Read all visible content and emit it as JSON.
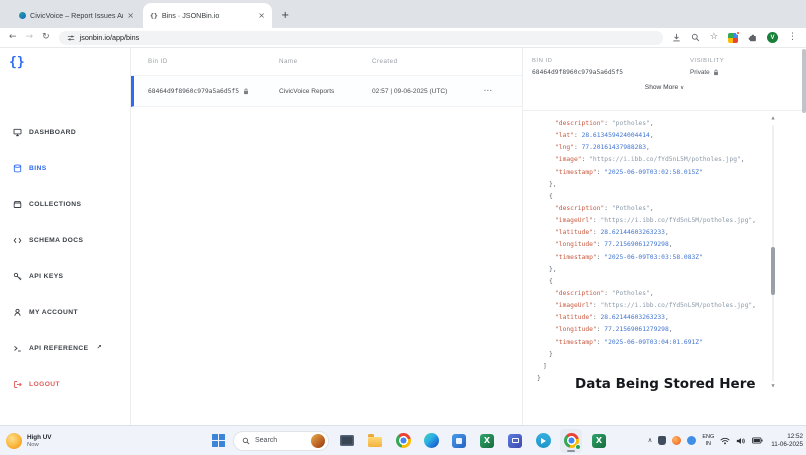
{
  "colors": {
    "accent": "#2e6bf0",
    "danger": "#e25c5c"
  },
  "browser": {
    "tabs": [
      {
        "title": "CivicVoice – Report Issues Ano",
        "active": false
      },
      {
        "title": "Bins · JSONBin.io",
        "active": true
      }
    ],
    "url": "jsonbin.io/app/bins",
    "avatar_letter": "V"
  },
  "icons": {
    "back": "←",
    "forward": "→",
    "reload": "↻",
    "plus": "+",
    "close": "×",
    "star": "☆",
    "menu": "⋮",
    "row_menu": "⋯",
    "chevron_down": "∨",
    "chevron_up": "∧",
    "scroll_up": "▲",
    "scroll_down": "▼",
    "external": "↗",
    "braces": "{}",
    "excel_letter": "X"
  },
  "sidebar": {
    "logo": "{}",
    "items": [
      {
        "label": "DASHBOARD"
      },
      {
        "label": "BINS",
        "active": true
      },
      {
        "label": "COLLECTIONS"
      },
      {
        "label": "SCHEMA DOCS"
      },
      {
        "label": "API KEYS"
      },
      {
        "label": "MY ACCOUNT"
      },
      {
        "label": "API REFERENCE",
        "external": true
      },
      {
        "label": "LOGOUT",
        "danger": true
      }
    ]
  },
  "bins_table": {
    "headers": {
      "bin_id": "Bin ID",
      "name": "Name",
      "created": "Created"
    },
    "rows": [
      {
        "bin_id": "68464d9f8960c979a5a6d5f5",
        "name": "CivicVoice Reports",
        "created": "02:57 | 09-06-2025 (UTC)"
      }
    ]
  },
  "detail": {
    "bin_id_label": "BIN ID",
    "bin_id": "68464d9f8960c979a5a6d5f5",
    "visibility_label": "VISIBILITY",
    "visibility": "Private",
    "show_more": "Show More",
    "annotation": "Data Being Stored Here"
  },
  "code": {
    "colors": {
      "key": "#c85a40",
      "string": "#8a99a8",
      "number": "#3f74d1",
      "punct": "#5b6570"
    },
    "lines": [
      {
        "ind": 3,
        "t": [
          [
            "k",
            "\"description\""
          ],
          [
            "p",
            ": "
          ],
          [
            "s",
            "\"potholes\""
          ],
          [
            "p",
            ","
          ]
        ]
      },
      {
        "ind": 3,
        "t": [
          [
            "k",
            "\"lat\""
          ],
          [
            "p",
            ": "
          ],
          [
            "n",
            "28.613459424004414"
          ],
          [
            "p",
            ","
          ]
        ]
      },
      {
        "ind": 3,
        "t": [
          [
            "k",
            "\"lng\""
          ],
          [
            "p",
            ": "
          ],
          [
            "n",
            "77.20161437988283"
          ],
          [
            "p",
            ","
          ]
        ]
      },
      {
        "ind": 3,
        "t": [
          [
            "k",
            "\"image\""
          ],
          [
            "p",
            ": "
          ],
          [
            "s",
            "\"https://i.ibb.co/fYd5nL5M/potholes.jpg\""
          ],
          [
            "p",
            ","
          ]
        ]
      },
      {
        "ind": 3,
        "t": [
          [
            "k",
            "\"timestamp\""
          ],
          [
            "p",
            ": "
          ],
          [
            "n",
            "\"2025-06-09T03:02:58.015Z\""
          ]
        ]
      },
      {
        "ind": 2,
        "t": [
          [
            "p",
            "},"
          ]
        ]
      },
      {
        "ind": 2,
        "t": [
          [
            "p",
            "{"
          ]
        ]
      },
      {
        "ind": 3,
        "t": [
          [
            "k",
            "\"description\""
          ],
          [
            "p",
            ": "
          ],
          [
            "s",
            "\"Potholes\""
          ],
          [
            "p",
            ","
          ]
        ]
      },
      {
        "ind": 3,
        "t": [
          [
            "k",
            "\"imageUrl\""
          ],
          [
            "p",
            ": "
          ],
          [
            "s",
            "\"https://i.ibb.co/fYd5nL5M/potholes.jpg\""
          ],
          [
            "p",
            ","
          ]
        ]
      },
      {
        "ind": 3,
        "t": [
          [
            "k",
            "\"latitude\""
          ],
          [
            "p",
            ": "
          ],
          [
            "n",
            "28.62144603263233"
          ],
          [
            "p",
            ","
          ]
        ]
      },
      {
        "ind": 3,
        "t": [
          [
            "k",
            "\"longitude\""
          ],
          [
            "p",
            ": "
          ],
          [
            "n",
            "77.21569061279298"
          ],
          [
            "p",
            ","
          ]
        ]
      },
      {
        "ind": 3,
        "t": [
          [
            "k",
            "\"timestamp\""
          ],
          [
            "p",
            ": "
          ],
          [
            "n",
            "\"2025-06-09T03:03:58.083Z\""
          ]
        ]
      },
      {
        "ind": 2,
        "t": [
          [
            "p",
            "},"
          ]
        ]
      },
      {
        "ind": 2,
        "t": [
          [
            "p",
            "{"
          ]
        ]
      },
      {
        "ind": 3,
        "t": [
          [
            "k",
            "\"description\""
          ],
          [
            "p",
            ": "
          ],
          [
            "s",
            "\"Potholes\""
          ],
          [
            "p",
            ","
          ]
        ]
      },
      {
        "ind": 3,
        "t": [
          [
            "k",
            "\"imageUrl\""
          ],
          [
            "p",
            ": "
          ],
          [
            "s",
            "\"https://i.ibb.co/fYd5nL5M/potholes.jpg\""
          ],
          [
            "p",
            ","
          ]
        ]
      },
      {
        "ind": 3,
        "t": [
          [
            "k",
            "\"latitude\""
          ],
          [
            "p",
            ": "
          ],
          [
            "n",
            "28.62144603263233"
          ],
          [
            "p",
            ","
          ]
        ]
      },
      {
        "ind": 3,
        "t": [
          [
            "k",
            "\"longitude\""
          ],
          [
            "p",
            ": "
          ],
          [
            "n",
            "77.21569061279298"
          ],
          [
            "p",
            ","
          ]
        ]
      },
      {
        "ind": 3,
        "t": [
          [
            "k",
            "\"timestamp\""
          ],
          [
            "p",
            ": "
          ],
          [
            "n",
            "\"2025-06-09T03:04:01.691Z\""
          ]
        ]
      },
      {
        "ind": 2,
        "t": [
          [
            "p",
            "}"
          ]
        ]
      },
      {
        "ind": 1,
        "t": [
          [
            "p",
            "]"
          ]
        ]
      },
      {
        "ind": 0,
        "t": [
          [
            "p",
            "}"
          ]
        ]
      }
    ]
  },
  "taskbar": {
    "weather_line1": "High UV",
    "weather_line2": "Now",
    "search_placeholder": "Search",
    "lang_line1": "ENG",
    "lang_line2": "IN",
    "time": "12:52",
    "date": "11-06-2025"
  }
}
